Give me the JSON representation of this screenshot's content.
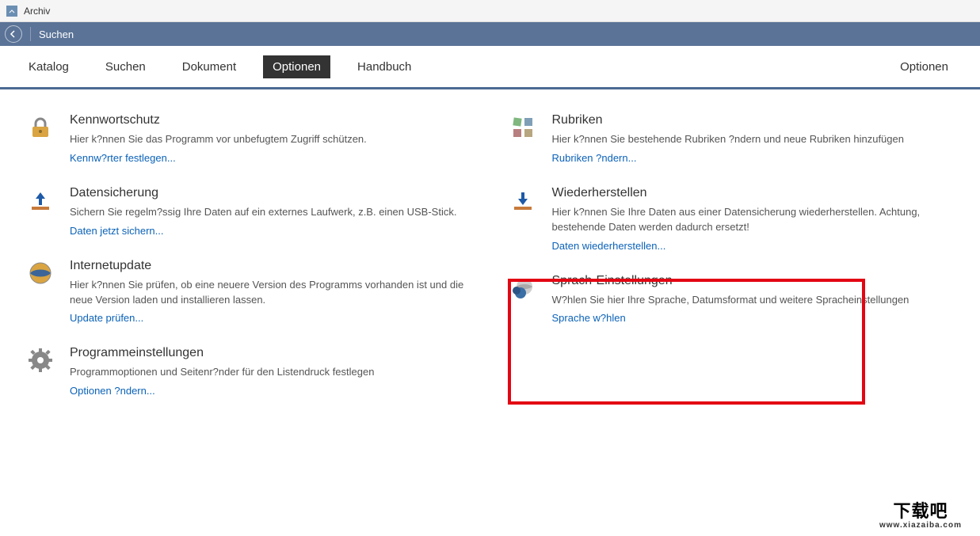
{
  "titlebar": {
    "title": "Archiv"
  },
  "navbar": {
    "search": "Suchen"
  },
  "tabs": {
    "katalog": "Katalog",
    "suchen": "Suchen",
    "dokument": "Dokument",
    "optionen": "Optionen",
    "handbuch": "Handbuch",
    "right": "Optionen"
  },
  "left": [
    {
      "title": "Kennwortschutz",
      "desc": "Hier k?nnen Sie das Programm vor unbefugtem Zugriff schützen.",
      "link": "Kennw?rter festlegen..."
    },
    {
      "title": "Datensicherung",
      "desc": "Sichern Sie regelm?ssig Ihre Daten auf ein externes Laufwerk, z.B. einen USB-Stick.",
      "link": "Daten jetzt sichern..."
    },
    {
      "title": "Internetupdate",
      "desc": "Hier k?nnen Sie prüfen, ob eine neuere Version des Programms vorhanden ist und die neue Version laden und installieren lassen.",
      "link": "Update prüfen..."
    },
    {
      "title": "Programmeinstellungen",
      "desc": "Programmoptionen und Seitenr?nder für den Listendruck festlegen",
      "link": "Optionen ?ndern..."
    }
  ],
  "right": [
    {
      "title": "Rubriken",
      "desc": "Hier k?nnen Sie bestehende Rubriken ?ndern und neue Rubriken hinzufügen",
      "link": "Rubriken ?ndern..."
    },
    {
      "title": "Wiederherstellen",
      "desc": "Hier k?nnen Sie Ihre Daten aus einer Datensicherung wiederherstellen. Achtung, bestehende Daten werden dadurch ersetzt!",
      "link": "Daten wiederherstellen..."
    },
    {
      "title": "Sprach-Einstellungen",
      "desc": "W?hlen Sie hier Ihre Sprache, Datumsformat und weitere Spracheinstellungen",
      "link": "Sprache w?hlen"
    }
  ],
  "watermark": {
    "big": "下载吧",
    "small": "www.xiazaiba.com"
  }
}
